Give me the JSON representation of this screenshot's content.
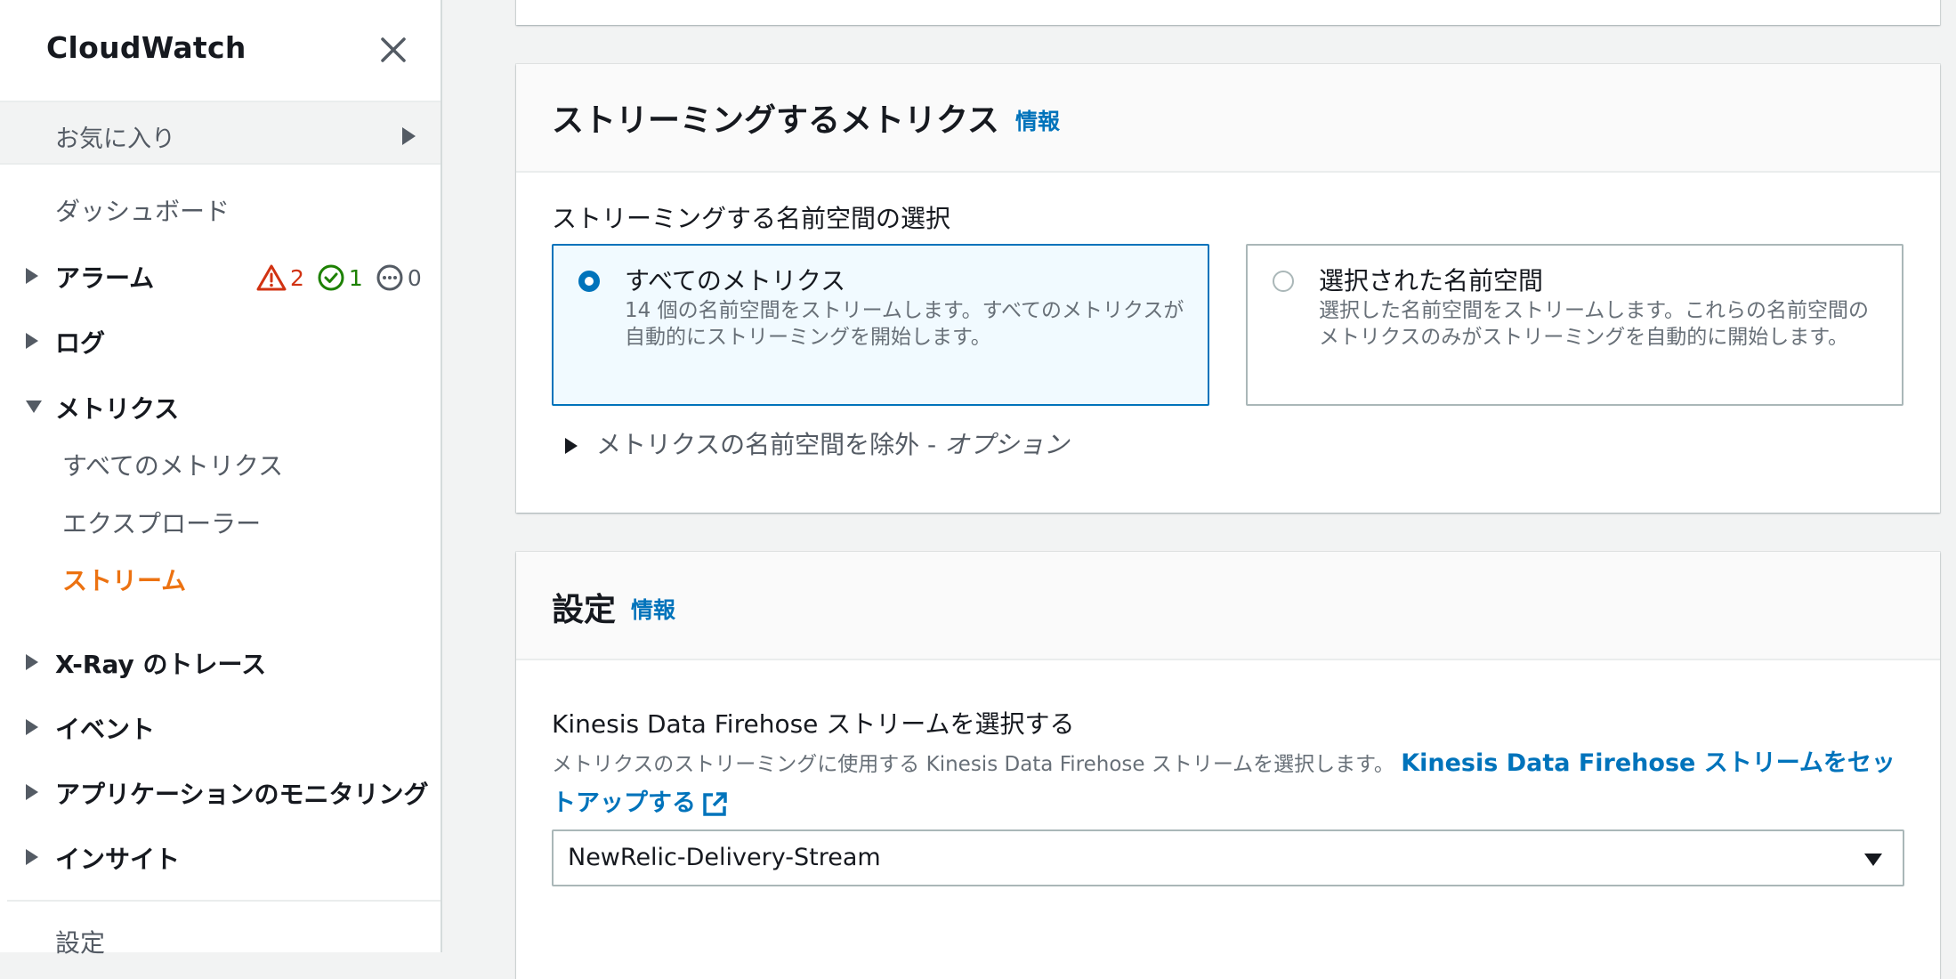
{
  "sidebar": {
    "title": "CloudWatch",
    "favorites": "お気に入り",
    "items": {
      "dashboard": "ダッシュボード",
      "alarms": "アラーム",
      "logs": "ログ",
      "metrics": "メトリクス",
      "all_metrics": "すべてのメトリクス",
      "explorer": "エクスプローラー",
      "streams": "ストリーム",
      "xray": "X-Ray のトレース",
      "events": "イベント",
      "app_monitoring": "アプリケーションのモニタリング",
      "insights": "インサイト",
      "settings": "設定"
    },
    "alarm_counts": {
      "alarm": "2",
      "ok": "1",
      "insufficient": "0"
    }
  },
  "streaming_panel": {
    "title": "ストリーミングするメトリクス",
    "info": "情報",
    "namespace_label": "ストリーミングする名前空間の選択",
    "options": [
      {
        "title": "すべてのメトリクス",
        "desc": "14 個の名前空間をストリームします。すべてのメトリクスが自動的にストリーミングを開始します。",
        "selected": true
      },
      {
        "title": "選択された名前空間",
        "desc": "選択した名前空間をストリームします。これらの名前空間のメトリクスのみがストリーミングを自動的に開始します。",
        "selected": false
      }
    ],
    "exclude_label": "メトリクスの名前空間を除外 - ",
    "exclude_optional": "オプション"
  },
  "settings_panel": {
    "title": "設定",
    "info": "情報",
    "firehose_label": "Kinesis Data Firehose ストリームを選択する",
    "firehose_desc": "メトリクスのストリーミングに使用する Kinesis Data Firehose ストリームを選択します。",
    "firehose_link": "Kinesis Data Firehose ストリームをセットアップする",
    "selected_stream": "NewRelic-Delivery-Stream"
  },
  "colors": {
    "accent": "#0073bb",
    "active_nav": "#ec7211",
    "alarm": "#d13212",
    "ok": "#1d8102"
  }
}
